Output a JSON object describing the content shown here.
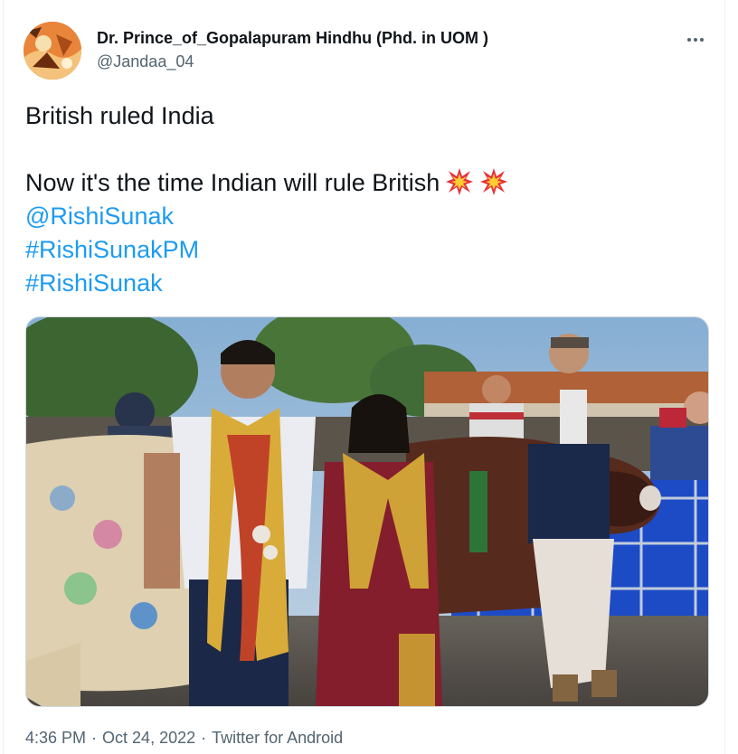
{
  "author": {
    "display_name": "Dr. Prince_of_Gopalapuram Hindhu (Phd. in UOM )",
    "handle": "@Jandaa_04",
    "avatar_icon": "avatar-image"
  },
  "more_icon": "more-horizontal-icon",
  "tweet": {
    "line1": "British ruled India",
    "line2": "Now it's the time  Indian will rule British",
    "emoji_icon": "collision-emoji",
    "mention": "@RishiSunak",
    "hashtags": [
      "#RishiSunakPM",
      "#RishiSunak"
    ]
  },
  "media": {
    "icon": "photo-image",
    "description_type": "photo"
  },
  "meta": {
    "time": "4:36 PM",
    "separator": "·",
    "date": "Oct 24, 2022",
    "source": "Twitter for Android"
  },
  "colors": {
    "link": "#1d9bf0",
    "secondary_text": "#536471",
    "primary_text": "#0f1419",
    "border": "#cfd9de"
  }
}
